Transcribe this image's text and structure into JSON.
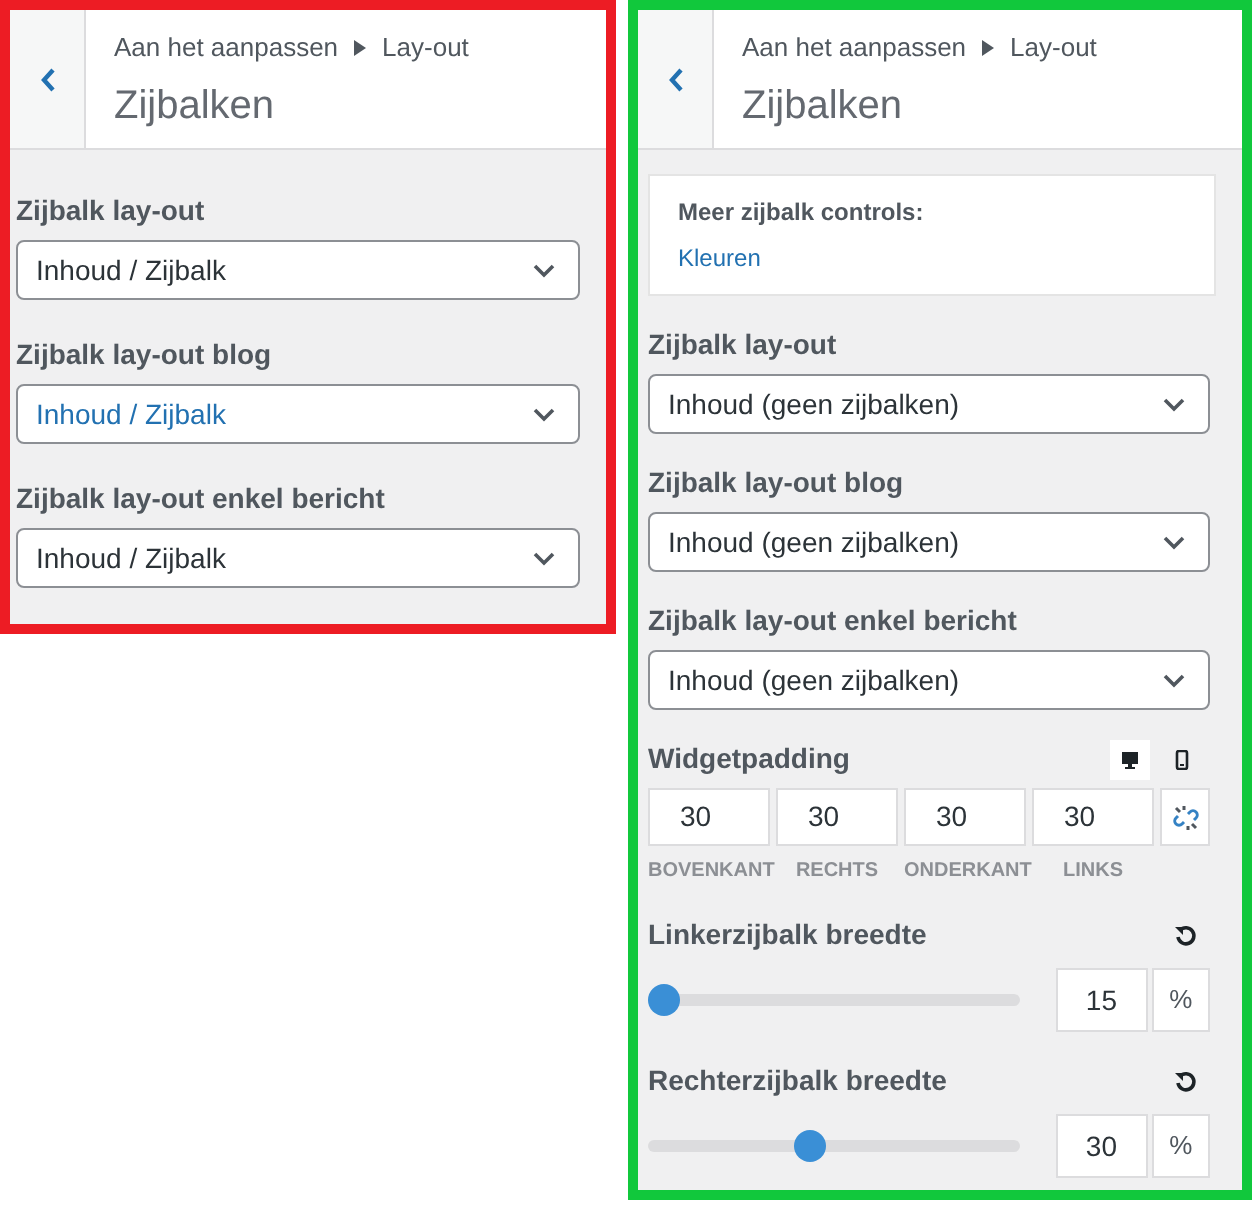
{
  "panels": [
    {
      "color": "#ed1c24",
      "breadcrumb": "Aan het aanpassen",
      "breadcrumb_current": "Lay-out",
      "title": "Zijbalken",
      "sections": [
        {
          "kind": "select",
          "label": "Zijbalk lay-out",
          "value": "Inhoud / Zijbalk",
          "focused": false
        },
        {
          "kind": "select",
          "label": "Zijbalk lay-out blog",
          "value": "Inhoud / Zijbalk",
          "focused": true
        },
        {
          "kind": "select",
          "label": "Zijbalk lay-out enkel bericht",
          "value": "Inhoud / Zijbalk",
          "focused": false
        }
      ]
    },
    {
      "color": "#11c83c",
      "breadcrumb": "Aan het aanpassen",
      "breadcrumb_current": "Lay-out",
      "title": "Zijbalken",
      "sections": [
        {
          "kind": "note",
          "heading": "Meer zijbalk controls:",
          "link": "Kleuren"
        },
        {
          "kind": "select",
          "label": "Zijbalk lay-out",
          "value": "Inhoud (geen zijbalken)",
          "focused": false
        },
        {
          "kind": "select",
          "label": "Zijbalk lay-out blog",
          "value": "Inhoud (geen zijbalken)",
          "focused": false
        },
        {
          "kind": "select",
          "label": "Zijbalk lay-out enkel bericht",
          "value": "Inhoud (geen zijbalken)",
          "focused": false
        },
        {
          "kind": "padding",
          "label": "Widgetpadding",
          "linked": false,
          "devices": [
            {
              "kind": "desktop",
              "selected": true
            },
            {
              "kind": "mobile",
              "selected": false
            }
          ],
          "fields": [
            {
              "value": "30",
              "caption": "BOVENKANT"
            },
            {
              "value": "30",
              "caption": "RECHTS"
            },
            {
              "value": "30",
              "caption": "ONDERKANT"
            },
            {
              "value": "30",
              "caption": "LINKS"
            }
          ]
        },
        {
          "kind": "slider",
          "label": "Linkerzijbalk breedte",
          "level": 0,
          "value": "15",
          "unit": "%"
        },
        {
          "kind": "slider",
          "label": "Rechterzijbalk breedte",
          "level": 0.43,
          "value": "30",
          "unit": "%"
        }
      ]
    }
  ]
}
